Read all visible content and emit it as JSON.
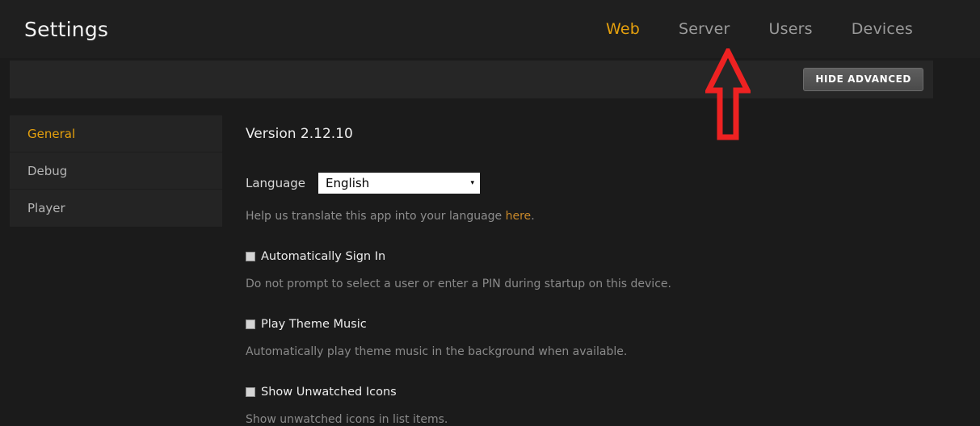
{
  "header": {
    "title": "Settings",
    "tabs": [
      {
        "label": "Web",
        "active": true
      },
      {
        "label": "Server",
        "active": false
      },
      {
        "label": "Users",
        "active": false
      },
      {
        "label": "Devices",
        "active": false
      }
    ],
    "active_tab_color": "#e5a00d"
  },
  "toolbar": {
    "advanced_button_label": "HIDE ADVANCED"
  },
  "sidebar": {
    "items": [
      {
        "label": "General",
        "active": true
      },
      {
        "label": "Debug",
        "active": false
      },
      {
        "label": "Player",
        "active": false
      }
    ]
  },
  "main": {
    "version_text": "Version 2.12.10",
    "language": {
      "label": "Language",
      "selected": "English",
      "caret": "▾"
    },
    "translate_help": {
      "prefix": "Help us translate this app into your language ",
      "link": "here",
      "suffix": "."
    },
    "settings": [
      {
        "label": "Automatically Sign In",
        "checked": false,
        "description": "Do not prompt to select a user or enter a PIN during startup on this device."
      },
      {
        "label": "Play Theme Music",
        "checked": false,
        "description": "Automatically play theme music in the background when available."
      },
      {
        "label": "Show Unwatched Icons",
        "checked": false,
        "description": "Show unwatched icons in list items."
      }
    ]
  },
  "annotation": {
    "arrow_color": "#ee2222",
    "points_to": "Server"
  }
}
